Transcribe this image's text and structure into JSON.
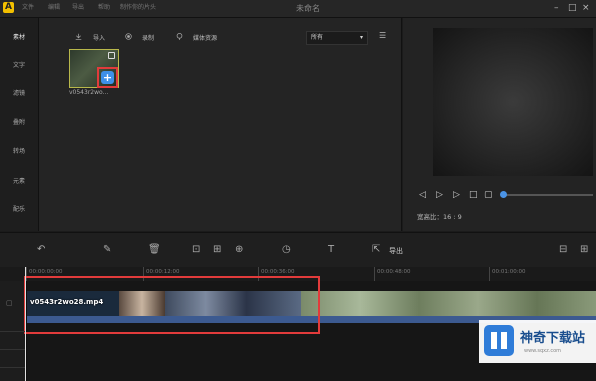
{
  "app": {
    "title": "未命名",
    "logo": "A"
  },
  "menu": [
    "文件",
    "编辑",
    "导出",
    "帮助",
    "制作你的片头"
  ],
  "sidebar": {
    "items": [
      "素材",
      "文字",
      "滤镜",
      "叠附",
      "转场",
      "元素",
      "配乐"
    ],
    "active_index": 0
  },
  "media": {
    "import_label": "导入",
    "record_label": "录制",
    "download_label": "媒体资源",
    "filter_value": "所有",
    "clip_name": "v0543r2wo..."
  },
  "preview": {
    "ratio_label": "宽高比：16 : 9",
    "progress": 0.0
  },
  "edit_toolbar": {
    "export_label": "导出"
  },
  "ruler": {
    "ticks": [
      "00:00:00:00",
      "00:00:12:00",
      "00:00:36:00",
      "00:00:48:00",
      "00:01:00:00"
    ]
  },
  "timeline": {
    "clip_label": "v0543r2wo28.mp4"
  },
  "watermark": {
    "title": "神奇下载站",
    "url": "www.sqxz.com"
  },
  "colors": {
    "accent": "#3e90e8",
    "highlight": "#e23b3b",
    "logo": "#f3c000"
  }
}
